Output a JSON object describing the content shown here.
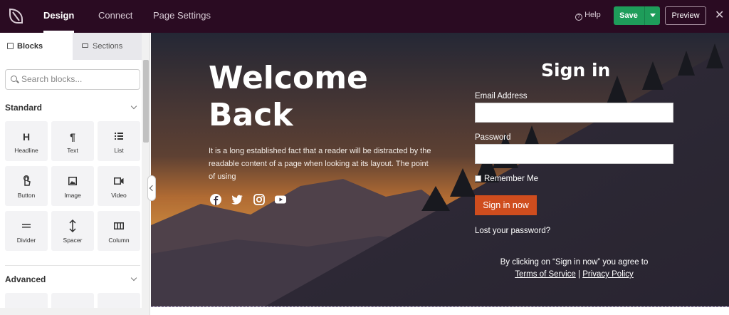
{
  "topbar": {
    "tabs": [
      {
        "label": "Design",
        "active": true
      },
      {
        "label": "Connect",
        "active": false
      },
      {
        "label": "Page Settings",
        "active": false
      }
    ],
    "help_label": "Help",
    "save_label": "Save",
    "preview_label": "Preview",
    "close_icon": "close-icon"
  },
  "sidebar": {
    "tabs": {
      "blocks": "Blocks",
      "sections": "Sections"
    },
    "search_placeholder": "Search blocks...",
    "groups": [
      {
        "title": "Standard",
        "blocks": [
          {
            "label": "Headline",
            "icon": "H"
          },
          {
            "label": "Text",
            "icon": "¶"
          },
          {
            "label": "List",
            "icon": "list-icon"
          },
          {
            "label": "Button",
            "icon": "pointer-icon"
          },
          {
            "label": "Image",
            "icon": "image-icon"
          },
          {
            "label": "Video",
            "icon": "video-icon"
          },
          {
            "label": "Divider",
            "icon": "divider-icon"
          },
          {
            "label": "Spacer",
            "icon": "spacer-icon"
          },
          {
            "label": "Column",
            "icon": "column-icon"
          }
        ]
      },
      {
        "title": "Advanced"
      }
    ]
  },
  "canvas": {
    "heading": "Welcome Back",
    "description": "It is a long established fact that a reader will be distracted by the readable content of a page when looking at its layout. The point of using",
    "social_icons": [
      "facebook-icon",
      "twitter-icon",
      "instagram-icon",
      "youtube-icon"
    ],
    "signin": {
      "title": "Sign in",
      "email_label": "Email Address",
      "password_label": "Password",
      "remember_label": "Remember Me",
      "button_label": "Sign in now",
      "lost_password": "Lost your password?",
      "terms_prefix": "By clicking on “Sign in now” you agree to",
      "terms_link": "Terms of Service",
      "separator": "|",
      "privacy_link": "Privacy Policy"
    }
  },
  "colors": {
    "topbar": "#2a0b22",
    "save": "#1e9d5a",
    "signin_button": "#cf4d1e"
  }
}
